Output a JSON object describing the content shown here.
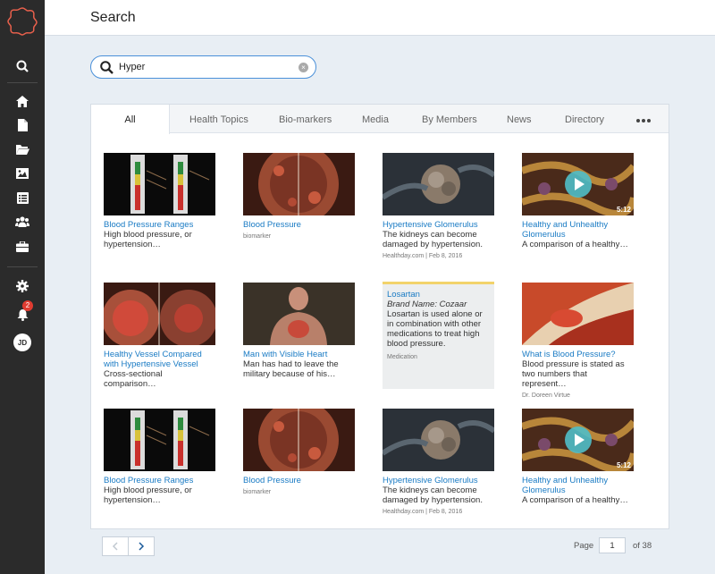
{
  "header": {
    "title": "Search"
  },
  "search": {
    "value": "Hyper",
    "placeholder": ""
  },
  "tabs": [
    "All",
    "Health Topics",
    "Bio-markers",
    "Media",
    "By Members",
    "News",
    "Directory"
  ],
  "sidebar": {
    "icons": [
      "search-icon",
      "home-icon",
      "document-icon",
      "folder-icon",
      "image-icon",
      "list-icon",
      "group-icon",
      "briefcase-icon",
      "gear-icon",
      "bell-icon"
    ],
    "notification_count": "2",
    "avatar_initials": "JD"
  },
  "results": [
    {
      "title": "Blood Pressure Ranges",
      "desc": "High blood pressure, or hypertension…",
      "meta": "",
      "thumb": "gauge"
    },
    {
      "title": "Blood Pressure",
      "desc": "",
      "meta": "biomarker",
      "thumb": "vessel"
    },
    {
      "title": "Hypertensive Glomerulus",
      "desc": "The kidneys can become damaged by hypertension.",
      "meta": "Healthday.com | Feb 8, 2016",
      "thumb": "kidney"
    },
    {
      "title": "Healthy and Unhealthy Glomerulus",
      "desc": "A comparison of a healthy…",
      "meta": "",
      "duration": "5:12",
      "thumb": "video"
    },
    {
      "title": "Healthy Vessel Compared with Hypertensive Vessel",
      "desc": "Cross-sectional comparison…",
      "meta": "",
      "thumb": "vessel2"
    },
    {
      "title": "Man with Visible Heart",
      "desc": "Man has had to leave the military because of his…",
      "meta": "",
      "thumb": "man"
    },
    {
      "title": "Losartan",
      "brand": "Brand Name: Cozaar",
      "desc": "Losartan is used alone or in combination with other medications to treat high blood pressure.",
      "meta": "Medication",
      "thumb": "text"
    },
    {
      "title": "What is Blood Pressure?",
      "desc": "Blood pressure is stated as two numbers that represent…",
      "meta": "Dr. Doreen Virtue",
      "thumb": "artery"
    },
    {
      "title": "Blood Pressure Ranges",
      "desc": "High blood pressure, or hypertension…",
      "meta": "",
      "thumb": "gauge"
    },
    {
      "title": "Blood Pressure",
      "desc": "",
      "meta": "biomarker",
      "thumb": "vessel"
    },
    {
      "title": "Hypertensive Glomerulus",
      "desc": "The kidneys can become damaged by hypertension.",
      "meta": "Healthday.com | Feb 8, 2016",
      "thumb": "kidney"
    },
    {
      "title": "Healthy and Unhealthy Glomerulus",
      "desc": "A comparison of a healthy…",
      "meta": "",
      "duration": "5:12",
      "thumb": "video"
    }
  ],
  "pagination": {
    "label": "Page",
    "current": "1",
    "total": "of 38"
  },
  "colors": {
    "accent": "#1a7bc4",
    "sidebar": "#2b2b2b",
    "logo": "#e8604c"
  }
}
